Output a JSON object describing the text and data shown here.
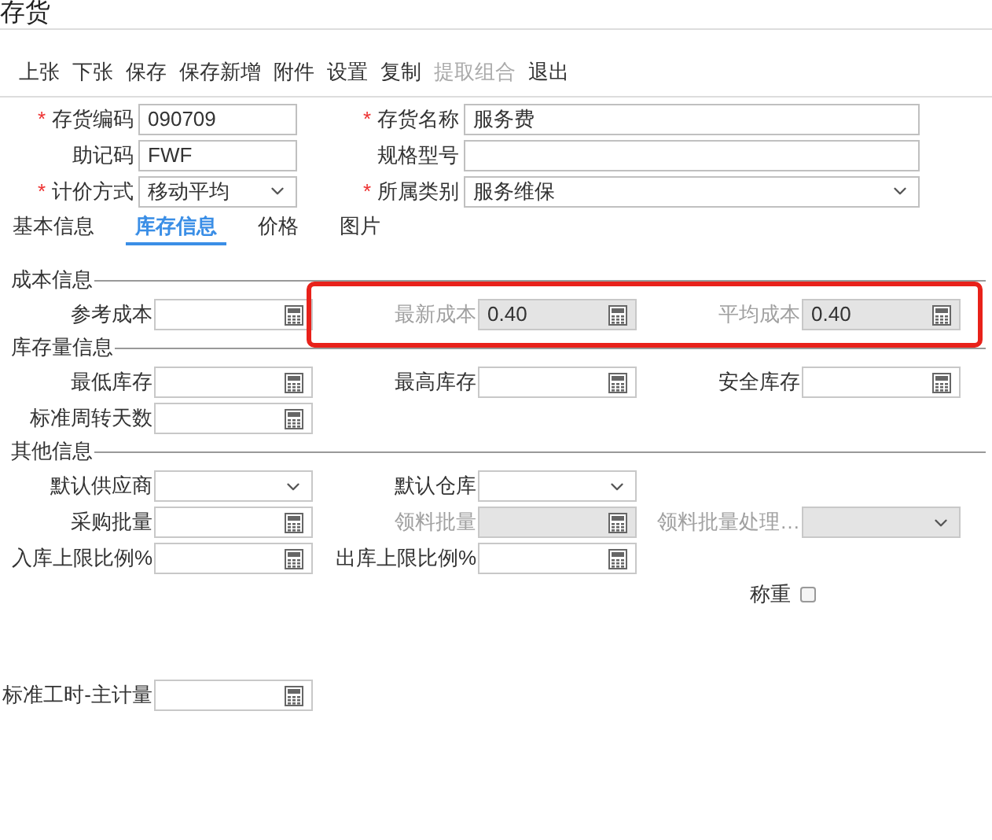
{
  "window": {
    "title": "存货"
  },
  "toolbar": [
    {
      "label": "上张",
      "disabled": false
    },
    {
      "label": "下张",
      "disabled": false
    },
    {
      "label": "保存",
      "disabled": false
    },
    {
      "label": "保存新增",
      "disabled": false
    },
    {
      "label": "附件",
      "disabled": false
    },
    {
      "label": "设置",
      "disabled": false
    },
    {
      "label": "复制",
      "disabled": false
    },
    {
      "label": "提取组合",
      "disabled": true
    },
    {
      "label": "退出",
      "disabled": false
    }
  ],
  "header_fields": [
    [
      {
        "required_mark": "*",
        "label": "存货编码",
        "kind": "text",
        "value": "090709"
      },
      {
        "required_mark": "*",
        "label": "存货名称",
        "kind": "text",
        "value": "服务费"
      }
    ],
    [
      {
        "label": "助记码",
        "kind": "text",
        "value": "FWF"
      },
      {
        "label": "规格型号",
        "kind": "text"
      }
    ],
    [
      {
        "required_mark": "*",
        "label": "计价方式",
        "kind": "select",
        "value": "移动平均"
      },
      {
        "required_mark": "*",
        "label": "所属类别",
        "kind": "select",
        "value": "服务维保"
      }
    ]
  ],
  "tabs": [
    {
      "label": "基本信息",
      "selected": false
    },
    {
      "label": "库存信息",
      "selected": true
    },
    {
      "label": "价格",
      "selected": false
    },
    {
      "label": "图片",
      "selected": false
    }
  ],
  "sections": [
    {
      "title": "成本信息",
      "rows": [
        [
          {
            "label": "参考成本",
            "kind": "calc",
            "disabled": false,
            "highlighted": false
          },
          {
            "label": "最新成本",
            "kind": "calc",
            "value": "0.40",
            "disabled": true,
            "highlighted": true
          },
          {
            "label": "平均成本",
            "kind": "calc",
            "value": "0.40",
            "disabled": true,
            "highlighted": true
          }
        ]
      ]
    },
    {
      "title": "库存量信息",
      "rows": [
        [
          {
            "label": "最低库存",
            "kind": "calc",
            "disabled": false,
            "highlighted": false
          },
          {
            "label": "最高库存",
            "kind": "calc",
            "disabled": false,
            "highlighted": false
          },
          {
            "label": "安全库存",
            "kind": "calc",
            "disabled": false,
            "highlighted": false
          }
        ],
        [
          {
            "label": "标准周转天数",
            "kind": "calc",
            "disabled": false,
            "highlighted": false
          }
        ]
      ]
    },
    {
      "title": "其他信息",
      "rows": [
        [
          {
            "label": "默认供应商",
            "kind": "select",
            "disabled": false,
            "highlighted": false
          },
          {
            "label": "默认仓库",
            "kind": "select",
            "disabled": false,
            "highlighted": false
          }
        ],
        [
          {
            "label": "采购批量",
            "kind": "calc",
            "disabled": false,
            "highlighted": false
          },
          {
            "label": "领料批量",
            "kind": "calc",
            "disabled": true,
            "highlighted": false
          },
          {
            "label": "领料批量处理…",
            "kind": "select",
            "disabled": true,
            "highlighted": false
          }
        ],
        [
          {
            "label": "入库上限比例%",
            "kind": "calc",
            "disabled": false,
            "highlighted": false
          },
          {
            "label": "出库上限比例%",
            "kind": "calc",
            "disabled": false,
            "highlighted": false
          }
        ],
        [
          "",
          "",
          {
            "label": "称重",
            "kind": "checkbox",
            "checked": false,
            "highlighted": false
          }
        ],
        [
          {
            "label": "标准工时-主计量",
            "kind": "calc",
            "disabled": false,
            "highlighted": false
          }
        ]
      ]
    }
  ]
}
